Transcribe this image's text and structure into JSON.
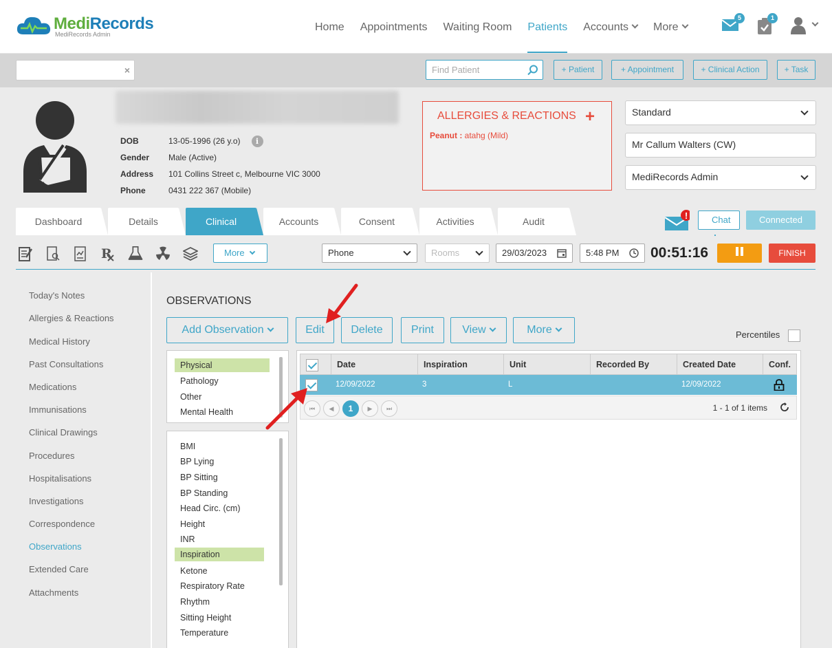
{
  "app": {
    "logo_name_1": "Medi",
    "logo_name_2": "Records",
    "logo_sub": "MediRecords Admin"
  },
  "nav": {
    "items": [
      {
        "label": "Home",
        "active": false,
        "dropdown": false
      },
      {
        "label": "Appointments",
        "active": false,
        "dropdown": false
      },
      {
        "label": "Waiting Room",
        "active": false,
        "dropdown": false
      },
      {
        "label": "Patients",
        "active": true,
        "dropdown": false
      },
      {
        "label": "Accounts",
        "active": false,
        "dropdown": true
      },
      {
        "label": "More",
        "active": false,
        "dropdown": true
      }
    ],
    "mail_badge": "5",
    "tasks_badge": "1"
  },
  "toolbar": {
    "quick_search_value": "",
    "clear_icon": "×",
    "find_patient_placeholder": "Find Patient",
    "buttons": [
      "+ Patient",
      "+ Appointment",
      "+ Clinical Action",
      "+ Task"
    ]
  },
  "patient": {
    "dob_label": "DOB",
    "dob": "13-05-1996 (26 y.o)",
    "gender_label": "Gender",
    "gender": "Male (Active)",
    "address_label": "Address",
    "address": "101 Collins Street c, Melbourne VIC 3000",
    "phone_label": "Phone",
    "phone": "0431 222 367 (Mobile)",
    "info_icon": "i"
  },
  "allergies": {
    "title": "ALLERGIES & REACTIONS",
    "add_icon": "+",
    "item_name": "Peanut :",
    "item_detail": " atahg (Mild)"
  },
  "selectors": {
    "billing": "Standard",
    "practitioner": "Mr Callum Walters (CW)",
    "location": "MediRecords Admin"
  },
  "tabs": [
    "Dashboard",
    "Details",
    "Clinical",
    "Accounts",
    "Consent",
    "Activities",
    "Audit"
  ],
  "active_tab": "Clinical",
  "chat": {
    "label": "Chat",
    "plus": "+",
    "status": "Connected",
    "alert": "!"
  },
  "clinical_bar": {
    "more_label": "More",
    "mode": "Phone",
    "rooms_placeholder": "Rooms",
    "date": "29/03/2023",
    "time": "5:48 PM",
    "timer": "00:51:16",
    "finish": "FINISH"
  },
  "left_nav": [
    "Today's Notes",
    "Allergies & Reactions",
    "Medical History",
    "Past Consultations",
    "Medications",
    "Immunisations",
    "Clinical Drawings",
    "Procedures",
    "Hospitalisations",
    "Investigations",
    "Correspondence",
    "Observations",
    "Extended Care",
    "Attachments"
  ],
  "left_nav_active": "Observations",
  "observations": {
    "title": "OBSERVATIONS",
    "buttons": {
      "add": "Add Observation",
      "edit": "Edit",
      "delete": "Delete",
      "print": "Print",
      "view": "View",
      "more": "More"
    },
    "percentiles_label": "Percentiles",
    "categories": [
      "Physical",
      "Pathology",
      "Other",
      "Mental Health"
    ],
    "selected_category": "Physical",
    "types": [
      "BMI",
      "BP Lying",
      "BP Sitting",
      "BP Standing",
      "Head Circ. (cm)",
      "Height",
      "INR",
      "Inspiration",
      "Ketone",
      "Respiratory Rate",
      "Rhythm",
      "Sitting Height",
      "Temperature"
    ],
    "selected_type": "Inspiration",
    "grid": {
      "columns": [
        "Date",
        "Inspiration",
        "Unit",
        "Recorded By",
        "Created Date",
        "Conf."
      ],
      "rows": [
        {
          "date": "12/09/2022",
          "inspiration": "3",
          "unit": "L",
          "recorded_by": "",
          "created_date": "12/09/2022",
          "conf_icon": "lock-icon",
          "checked": true
        }
      ],
      "current_page": "1",
      "pager_first": "⏮",
      "pager_prev": "◀",
      "pager_next": "▶",
      "pager_last": "⏭",
      "items_text": "1 - 1 of 1 items"
    }
  },
  "colors": {
    "accent": "#3fa6c8",
    "danger": "#e74c3c",
    "warning": "#f39c12",
    "selected_green": "#cde3a8"
  }
}
